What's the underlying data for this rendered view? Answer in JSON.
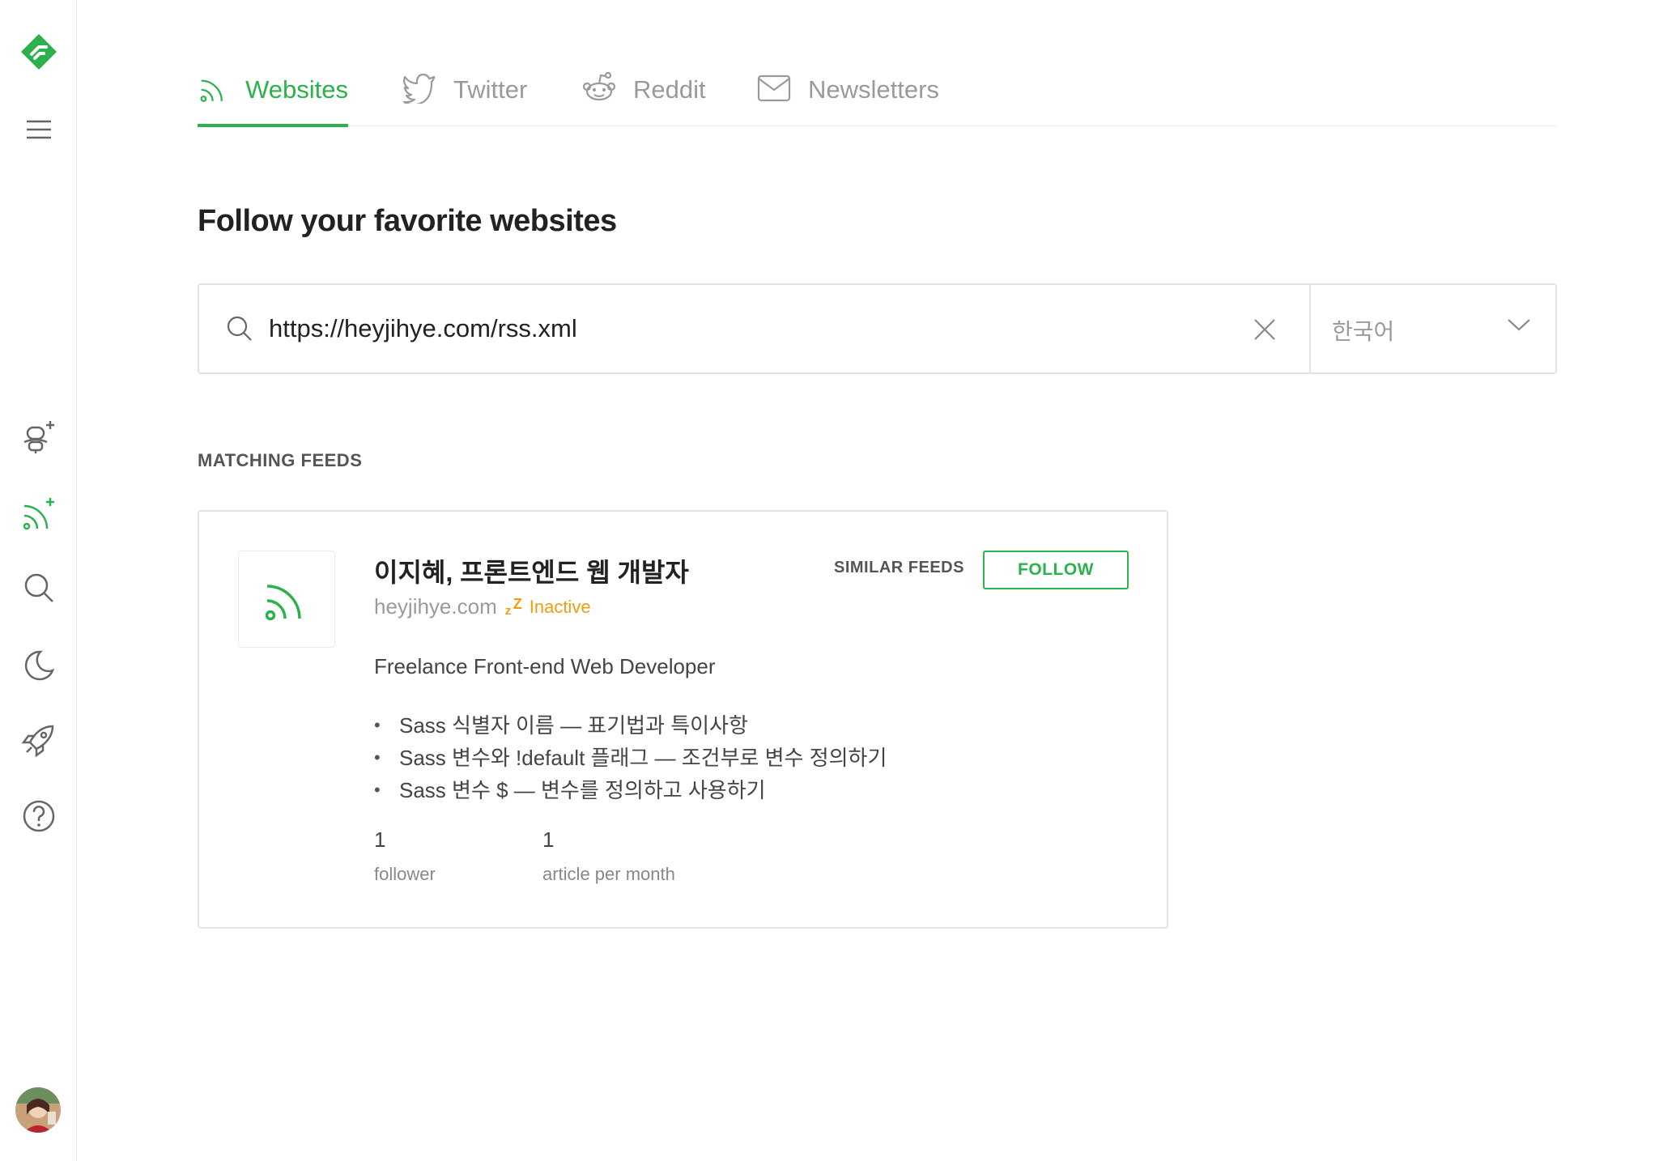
{
  "sidebar": {
    "icons": [
      "feedly-logo-icon",
      "menu-icon",
      "add-team-icon",
      "add-feed-icon",
      "search-icon",
      "night-mode-icon",
      "rocket-icon",
      "help-icon"
    ],
    "avatar": "user-avatar"
  },
  "tabs": [
    {
      "label": "Websites",
      "icon": "rss-icon",
      "active": true
    },
    {
      "label": "Twitter",
      "icon": "twitter-icon",
      "active": false
    },
    {
      "label": "Reddit",
      "icon": "reddit-icon",
      "active": false
    },
    {
      "label": "Newsletters",
      "icon": "mail-icon",
      "active": false
    }
  ],
  "page": {
    "title": "Follow your favorite websites"
  },
  "search": {
    "value": "https://heyjihye.com/rss.xml",
    "language": "한국어"
  },
  "results": {
    "section_label": "MATCHING FEEDS",
    "feed": {
      "title": "이지혜, 프론트엔드 웹 개발자",
      "domain": "heyjihye.com",
      "status_zz": "z",
      "status_zz_big": "Z",
      "status": "Inactive",
      "description": "Freelance Front-end Web Developer",
      "articles": [
        "Sass 식별자 이름 — 표기법과 특이사항",
        "Sass 변수와 !default 플래그 — 조건부로 변수 정의하기",
        "Sass 변수 $ — 변수를 정의하고 사용하기"
      ],
      "followers_count": "1",
      "followers_label": "follower",
      "articles_count": "1",
      "articles_label": "article per month",
      "similar_label": "SIMILAR FEEDS",
      "follow_label": "FOLLOW"
    }
  },
  "colors": {
    "accent": "#2bb24c",
    "inactive": "#f39c12",
    "muted": "#9a9a9a"
  }
}
